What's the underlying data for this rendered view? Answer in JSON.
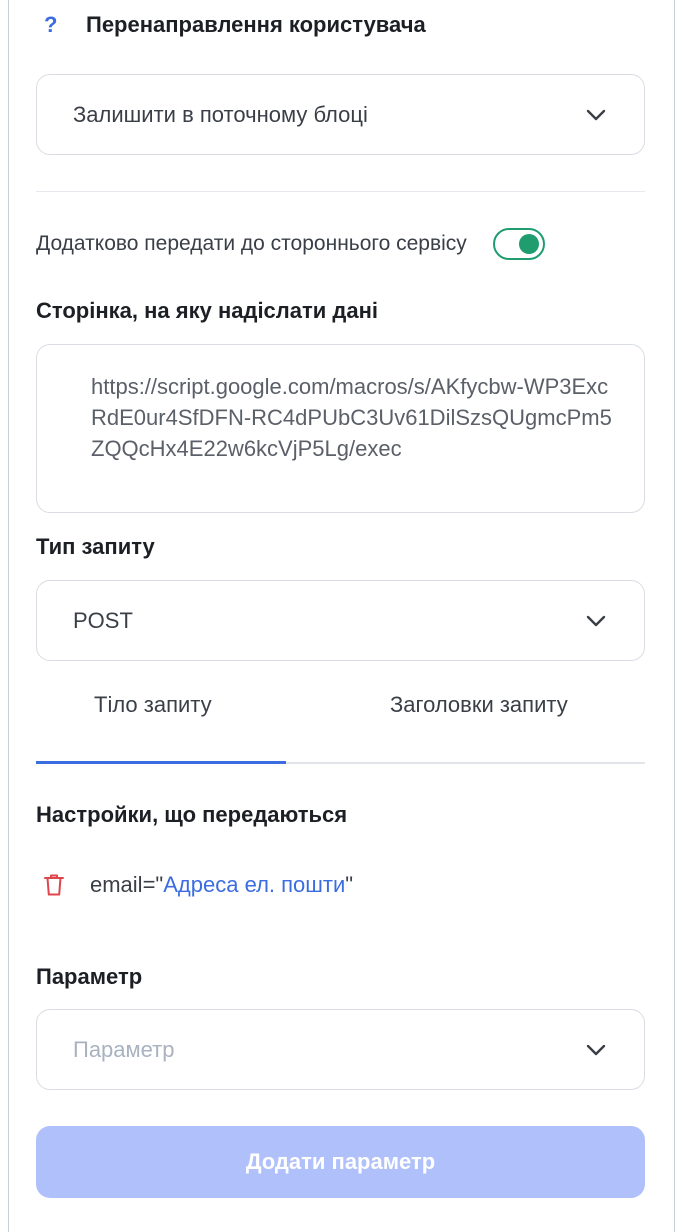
{
  "redirect": {
    "help_icon": "question-icon",
    "title": "Перенаправлення користувача",
    "selected": "Залишити в поточному блоці"
  },
  "forward": {
    "label": "Додатково передати до стороннього сервісу",
    "enabled": true
  },
  "target_page": {
    "label": "Сторінка, на яку надіслати дані",
    "value": "https://script.google.com/macros/s/AKfycbw-WP3ExcRdE0ur4SfDFN-RC4dPUbC3Uv61DilSzsQUgmcPm5ZQQcHx4E22w6kcVjP5Lg/exec"
  },
  "request_type": {
    "label": "Тип запиту",
    "selected": "POST"
  },
  "tabs": [
    {
      "label": "Тіло запиту",
      "active": true
    },
    {
      "label": "Заголовки запиту",
      "active": false
    }
  ],
  "settings": {
    "label": "Настройки, що передаються",
    "items": [
      {
        "key_prefix": "email=\"",
        "value": "Адреса ел. пошти",
        "suffix": "\""
      }
    ]
  },
  "parameter": {
    "label": "Параметр",
    "placeholder": "Параметр"
  },
  "add_button": "Додати параметр",
  "colors": {
    "accent": "#3b6de0",
    "toggle_on": "#1f9d6e",
    "button_disabled": "#b0c0fb",
    "delete": "#e0454b"
  }
}
